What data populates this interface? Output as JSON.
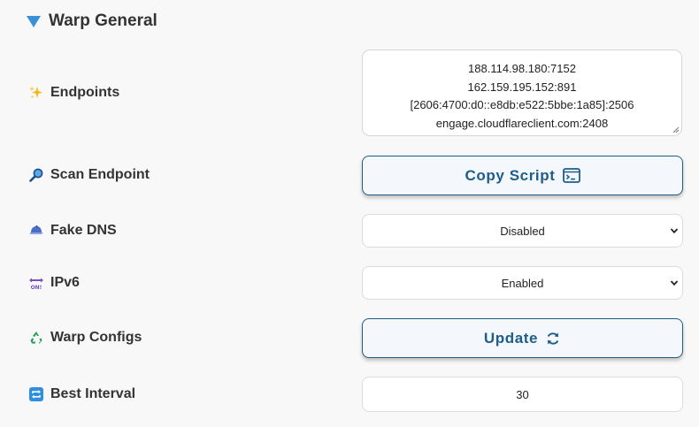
{
  "section": {
    "title": "Warp General"
  },
  "rows": {
    "endpoints": {
      "label": "Endpoints",
      "icon": "sparkles-icon",
      "lines": [
        "188.114.98.180:7152",
        "162.159.195.152:891",
        "[2606:4700:d0::e8db:e522:5bbe:1a85]:2506",
        "engage.cloudflareclient.com:2408"
      ]
    },
    "scan": {
      "label": "Scan Endpoint",
      "icon": "magnifier-icon",
      "button_label": "Copy Script",
      "button_icon": "terminal-icon"
    },
    "fake_dns": {
      "label": "Fake DNS",
      "icon": "cap-icon",
      "value": "Disabled"
    },
    "ipv6": {
      "label": "IPv6",
      "icon": "on-arrow-icon",
      "value": "Enabled"
    },
    "warp_configs": {
      "label": "Warp Configs",
      "icon": "recycle-icon",
      "button_label": "Update",
      "button_icon": "refresh-icon"
    },
    "best_interval": {
      "label": "Best Interval",
      "icon": "repeat-icon",
      "value": "30"
    }
  },
  "colors": {
    "accent": "#1e5d88",
    "triangle": "#3a8fd6",
    "background": "#f8f8f8"
  }
}
